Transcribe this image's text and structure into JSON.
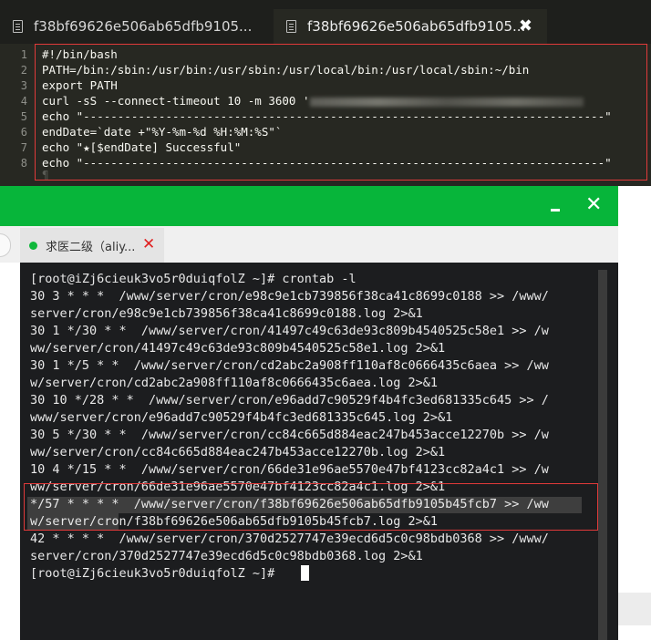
{
  "editor": {
    "tabs": [
      {
        "label": "f38bf69626e506ab65dfb9105..."
      },
      {
        "label": "f38bf69626e506ab65dfb9105...",
        "close": "✖"
      }
    ],
    "line_numbers": [
      "1",
      "2",
      "3",
      "4",
      "5",
      "6",
      "7",
      "8"
    ],
    "lines": [
      "#!/bin/bash",
      "PATH=/bin:/sbin:/usr/bin:/usr/sbin:/usr/local/bin:/usr/local/sbin:~/bin",
      "export PATH",
      "curl -sS --connect-timeout 10 -m 3600 '",
      "echo \"----------------------------------------------------------------------------\"",
      "endDate=`date +\"%Y-%m-%d %H:%M:%S\"`",
      "echo \"★[$endDate] Successful\"",
      "echo \"----------------------------------------------------------------------------\""
    ],
    "pilcrow": "¶"
  },
  "terminal": {
    "minimize_label": "",
    "close_label": "✕",
    "tab_label": "求医二级（aliy...",
    "tab_close": "✕",
    "lines": [
      "[root@iZj6cieuk3vo5r0duiqfolZ ~]# crontab -l",
      "30 3 * * *  /www/server/cron/e98c9e1cb739856f38ca41c8699c0188 >> /www/",
      "server/cron/e98c9e1cb739856f38ca41c8699c0188.log 2>&1",
      "30 1 */30 * *  /www/server/cron/41497c49c63de93c809b4540525c58e1 >> /w",
      "ww/server/cron/41497c49c63de93c809b4540525c58e1.log 2>&1",
      "30 1 */5 * *  /www/server/cron/cd2abc2a908ff110af8c0666435c6aea >> /ww",
      "w/server/cron/cd2abc2a908ff110af8c0666435c6aea.log 2>&1",
      "30 10 */28 * *  /www/server/cron/e96add7c90529f4b4fc3ed681335c645 >> /",
      "www/server/cron/e96add7c90529f4b4fc3ed681335c645.log 2>&1",
      "30 5 */30 * *  /www/server/cron/cc84c665d884eac247b453acce12270b >> /w",
      "ww/server/cron/cc84c665d884eac247b453acce12270b.log 2>&1",
      "10 4 */15 * *  /www/server/cron/66de31e96ae5570e47bf4123cc82a4c1 >> /w",
      "ww/server/cron/66de31e96ae5570e47bf4123cc82a4c1.log 2>&1",
      "*/57 * * * *  /www/server/cron/f38bf69626e506ab65dfb9105b45fcb7 >> /ww",
      "w/server/cron/f38bf69626e506ab65dfb9105b45fcb7.log 2>&1",
      "42 * * * *  /www/server/cron/370d2527747e39ecd6d5c0c98bdb0368 >> /www/",
      "server/cron/370d2527747e39ecd6d5c0c98bdb0368.log 2>&1",
      "[root@iZj6cieuk3vo5r0duiqfolZ ~]# "
    ]
  }
}
